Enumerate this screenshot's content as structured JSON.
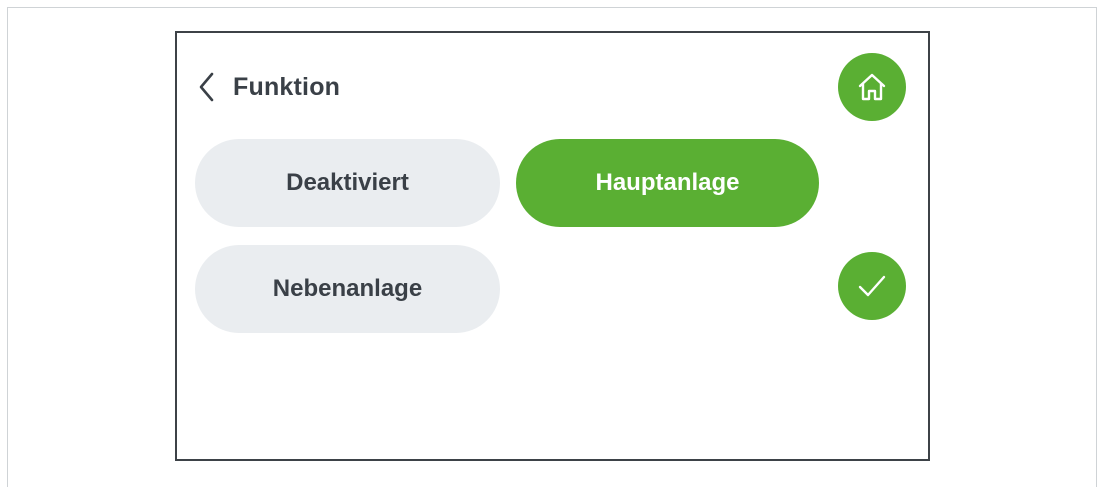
{
  "colors": {
    "accent": "#5aaf33",
    "inactive_bg": "#eaedf0",
    "text_dark": "#3a4047",
    "frame": "#3d4247"
  },
  "header": {
    "back_icon": "chevron-left-icon",
    "title": "Funktion",
    "home_icon": "home-icon"
  },
  "options": [
    {
      "label": "Deaktiviert",
      "selected": false
    },
    {
      "label": "Hauptanlage",
      "selected": true
    },
    {
      "label": "Nebenanlage",
      "selected": false
    }
  ],
  "confirm": {
    "icon": "checkmark-icon"
  }
}
